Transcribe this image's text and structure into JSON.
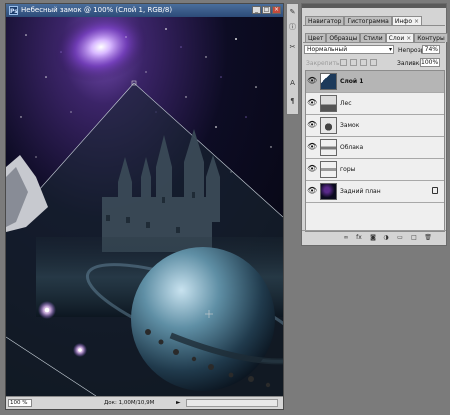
{
  "document": {
    "title": "Небесный замок @ 100% (Слой 1, RGB/8)",
    "app_icon": "Ps",
    "zoom": "100 %",
    "status": "Док: 1,00M/10,9M",
    "window_buttons": [
      "minimize-icon",
      "maximize-icon",
      "close-icon"
    ]
  },
  "panel": {
    "top_tabs": [
      {
        "label": "Навигатор",
        "active": false
      },
      {
        "label": "Гистограмма",
        "active": false
      },
      {
        "label": "Инфо",
        "active": true
      }
    ],
    "layer_tabs": [
      {
        "label": "Цвет",
        "active": false
      },
      {
        "label": "Образцы",
        "active": false
      },
      {
        "label": "Стили",
        "active": false
      },
      {
        "label": "Слои",
        "active": true
      },
      {
        "label": "Контуры",
        "active": false
      }
    ],
    "blend_mode": "Нормальный",
    "opacity_label": "Непрозр.:",
    "opacity_value": "74%",
    "lock_label": "Закрепить:",
    "fill_label": "Заливка:",
    "fill_value": "100%",
    "layers": [
      {
        "name": "Слой 1",
        "selected": true,
        "visible": true,
        "locked": false
      },
      {
        "name": "Лес",
        "selected": false,
        "visible": true,
        "locked": false
      },
      {
        "name": "Замок",
        "selected": false,
        "visible": true,
        "locked": false
      },
      {
        "name": "Облака",
        "selected": false,
        "visible": true,
        "locked": false
      },
      {
        "name": "горы",
        "selected": false,
        "visible": true,
        "locked": false
      },
      {
        "name": "Задний план",
        "selected": false,
        "visible": true,
        "locked": true
      }
    ],
    "footer_icons": [
      "link-icon",
      "fx-icon",
      "mask-icon",
      "adjustment-icon",
      "folder-icon",
      "new-layer-icon",
      "trash-icon"
    ]
  },
  "toolstrip": {
    "icons": [
      "eyedropper-icon",
      "info-icon",
      "brush-icon",
      "text-icon",
      "paragraph-icon"
    ]
  },
  "colors": {
    "title_bar": "#2c4b78",
    "panel_bg": "#d4d4d4",
    "selected_layer": "#b5b5b5",
    "workspace": "#7b7b7b"
  }
}
